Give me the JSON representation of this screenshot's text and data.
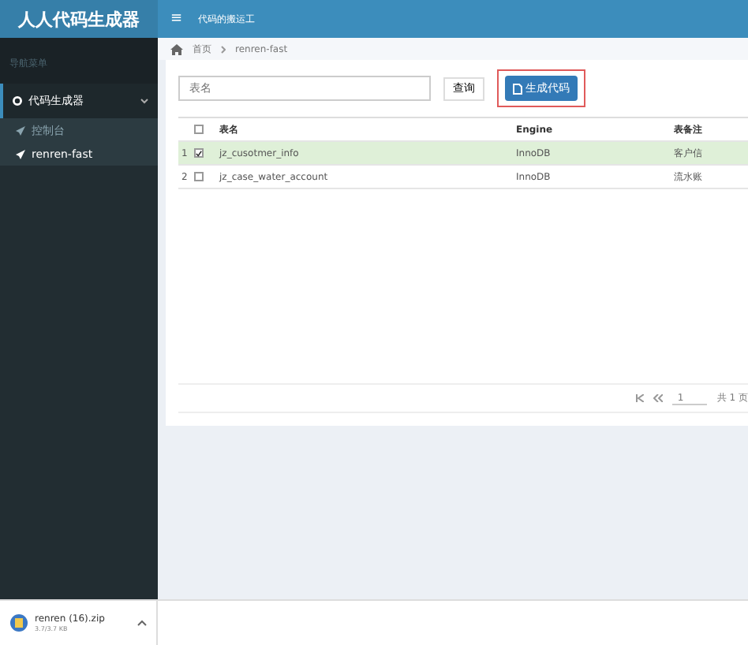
{
  "header": {
    "logo": "人人代码生成器",
    "menu_icon": "≡",
    "title": "代码的搬运工"
  },
  "sidebar": {
    "heading": "导航菜单",
    "groups": [
      {
        "label": "代码生成器",
        "expanded": true,
        "children": [
          {
            "label": "控制台",
            "selected": false
          },
          {
            "label": "renren-fast",
            "selected": true
          }
        ]
      }
    ]
  },
  "breadcrumb": [
    "首页",
    "renren-fast"
  ],
  "toolbar": {
    "search": {
      "placeholder": "表名"
    },
    "query_button": "查询",
    "generate_button": "生成代码"
  },
  "table": {
    "columns": [
      "表名",
      "Engine",
      "表备注"
    ],
    "all_checked": false,
    "rows": [
      {
        "index": "1",
        "checked": true,
        "selected": true,
        "cells": [
          "jz_cusotmer_info",
          "InnoDB",
          "客户信"
        ]
      },
      {
        "index": "2",
        "checked": false,
        "selected": false,
        "cells": [
          "jz_case_water_account",
          "InnoDB",
          "流水账"
        ]
      }
    ]
  },
  "pager": {
    "page": "1",
    "total": "共 1 页"
  },
  "download": {
    "file": "renren (16).zip",
    "size": "3.7/3.7 KB"
  }
}
